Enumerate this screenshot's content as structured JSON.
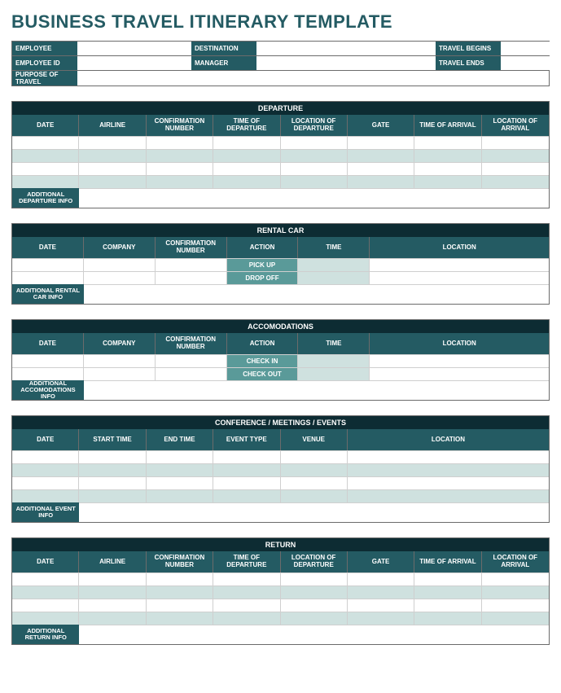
{
  "title": "BUSINESS TRAVEL ITINERARY TEMPLATE",
  "info": {
    "employee": "EMPLOYEE",
    "destination": "DESTINATION",
    "travel_begins": "TRAVEL BEGINS",
    "employee_id": "EMPLOYEE ID",
    "manager": "MANAGER",
    "travel_ends": "TRAVEL ENDS",
    "purpose": "PURPOSE OF TRAVEL"
  },
  "departure": {
    "title": "DEPARTURE",
    "headers": [
      "DATE",
      "AIRLINE",
      "CONFIRMATION NUMBER",
      "TIME OF DEPARTURE",
      "LOCATION OF DEPARTURE",
      "GATE",
      "TIME OF ARRIVAL",
      "LOCATION OF ARRIVAL"
    ],
    "footer": "ADDITIONAL DEPARTURE INFO"
  },
  "rental": {
    "title": "RENTAL CAR",
    "headers": [
      "DATE",
      "COMPANY",
      "CONFIRMATION NUMBER",
      "ACTION",
      "TIME",
      "LOCATION"
    ],
    "actions": [
      "PICK UP",
      "DROP OFF"
    ],
    "footer": "ADDITIONAL RENTAL CAR INFO"
  },
  "accom": {
    "title": "ACCOMODATIONS",
    "headers": [
      "DATE",
      "COMPANY",
      "CONFIRMATION NUMBER",
      "ACTION",
      "TIME",
      "LOCATION"
    ],
    "actions": [
      "CHECK IN",
      "CHECK OUT"
    ],
    "footer": "ADDITIONAL ACCOMODATIONS INFO"
  },
  "conf": {
    "title": "CONFERENCE / MEETINGS / EVENTS",
    "headers": [
      "DATE",
      "START TIME",
      "END TIME",
      "EVENT TYPE",
      "VENUE",
      "LOCATION"
    ],
    "footer": "ADDITIONAL EVENT INFO"
  },
  "return": {
    "title": "RETURN",
    "headers": [
      "DATE",
      "AIRLINE",
      "CONFIRMATION NUMBER",
      "TIME OF DEPARTURE",
      "LOCATION OF DEPARTURE",
      "GATE",
      "TIME OF ARRIVAL",
      "LOCATION OF ARRIVAL"
    ],
    "footer": "ADDITIONAL RETURN INFO"
  }
}
